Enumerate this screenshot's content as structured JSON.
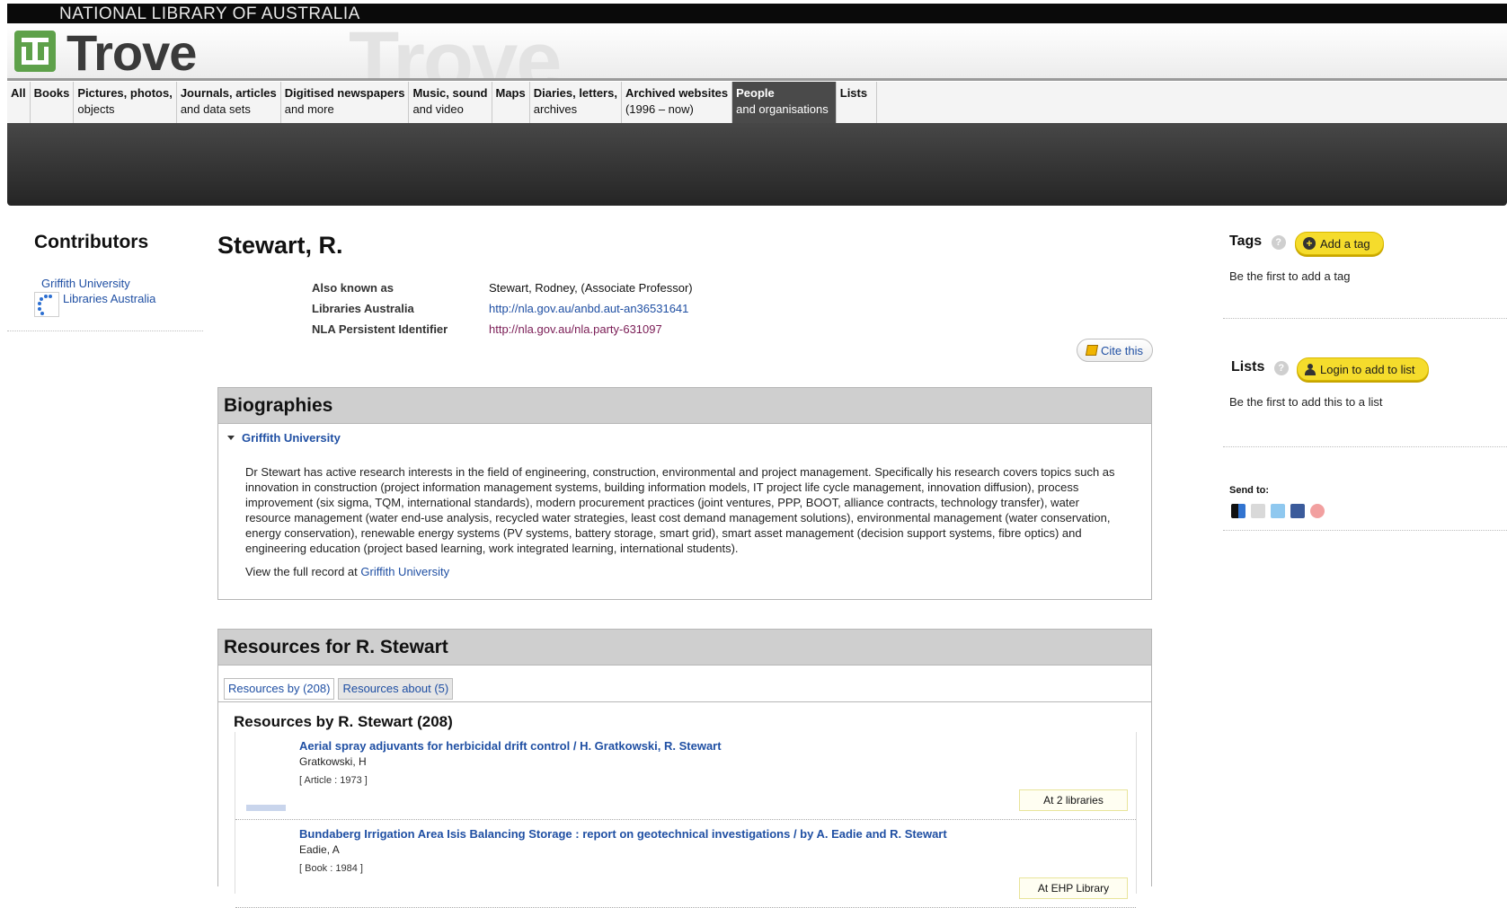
{
  "header": {
    "org": "NATIONAL LIBRARY OF AUSTRALIA",
    "brand": "Trove",
    "brand_ghost": "Trove"
  },
  "nav": {
    "tabs": [
      {
        "line1": "All",
        "line2": ""
      },
      {
        "line1": "Books",
        "line2": ""
      },
      {
        "line1": "Pictures, photos,",
        "line2": "objects"
      },
      {
        "line1": "Journals, articles",
        "line2": "and data sets"
      },
      {
        "line1": "Digitised newspapers",
        "line2": "and more"
      },
      {
        "line1": "Music, sound",
        "line2": "and video"
      },
      {
        "line1": "Maps",
        "line2": ""
      },
      {
        "line1": "Diaries, letters,",
        "line2": "archives"
      },
      {
        "line1": "Archived websites",
        "line2": "(1996 – now)"
      },
      {
        "line1": "People",
        "line2": "and organisations"
      },
      {
        "line1": "Lists",
        "line2": ""
      }
    ]
  },
  "contributors": {
    "title": "Contributors",
    "items": [
      "Griffith University",
      "Libraries Australia"
    ]
  },
  "record": {
    "title": "Stewart, R.",
    "meta": [
      {
        "label": "Also known as",
        "value": "Stewart, Rodney, (Associate Professor)"
      },
      {
        "label": "Libraries Australia",
        "value": "http://nla.gov.au/anbd.aut-an36531641"
      },
      {
        "label": "NLA Persistent Identifier",
        "value": "http://nla.gov.au/nla.party-631097"
      }
    ],
    "cite_label": "Cite this"
  },
  "biographies": {
    "title": "Biographies",
    "source": "Griffith University",
    "text": "Dr Stewart has active research interests in the field of engineering, construction, environmental and project management. Specifically his research covers topics such as innovation in construction (project information management systems, building information models, IT project life cycle management, innovation diffusion), process improvement (six sigma, TQM, international standards), modern procurement practices (joint ventures, PPP, BOOT, alliance contracts, technology transfer), water resource management (water end-use analysis, recycled water strategies, least cost demand management solutions), environmental management (water conservation, energy conservation), renewable energy systems (PV systems, battery storage, smart grid), smart asset management (decision support systems, fibre optics) and engineering education (project based learning, work integrated learning, international students).",
    "full_prefix": "View the full record at ",
    "full_link": "Griffith University"
  },
  "resources": {
    "title": "Resources for R. Stewart",
    "tabs": [
      "Resources by (208)",
      "Resources about (5)"
    ],
    "subtitle": "Resources by R. Stewart (208)",
    "items": [
      {
        "title": "Aerial spray adjuvants for herbicidal drift control / H. Gratkowski, R. Stewart",
        "author": "Gratkowski, H",
        "kind": "[ Article : 1973 ]",
        "avail": "At 2 libraries"
      },
      {
        "title": "Bundaberg Irrigation Area Isis Balancing Storage : report on geotechnical investigations / by A. Eadie and R. Stewart",
        "author": "Eadie, A",
        "kind": "[ Book : 1984 ]",
        "avail": "At EHP Library"
      }
    ]
  },
  "sidebar": {
    "tags_title": "Tags",
    "tags_button": "Add a tag",
    "tags_text": "Be the first to add a tag",
    "lists_title": "Lists",
    "lists_button": "Login to add to list",
    "lists_text": "Be the first to add this to a list",
    "sendto": "Send to:",
    "help_glyph": "?",
    "plus_glyph": "+"
  },
  "icons": [
    "trove-logo-icon",
    "loading-spinner-icon",
    "pencil-icon",
    "help-icon",
    "plus-icon",
    "person-icon",
    "delicious-icon",
    "email-icon",
    "twitter-icon",
    "facebook-icon",
    "share-icon"
  ],
  "colors": {
    "link": "#1f4fa3",
    "accent_yellow": "#f5dc2c",
    "green_logo": "#5ea14a"
  }
}
